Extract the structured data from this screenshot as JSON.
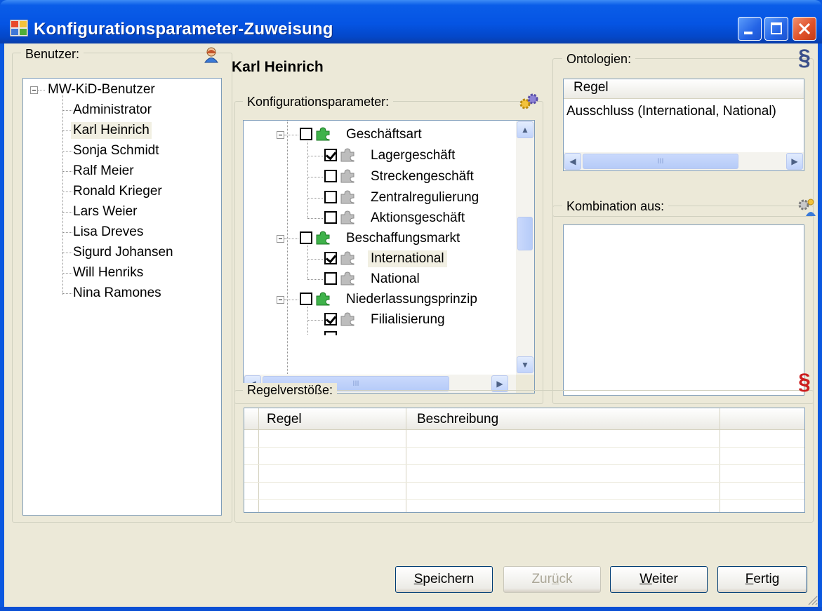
{
  "window": {
    "title": "Konfigurationsparameter-Zuweisung"
  },
  "users": {
    "label": "Benutzer:",
    "root": "MW-KiD-Benutzer",
    "items": [
      "Administrator",
      "Karl Heinrich",
      "Sonja Schmidt",
      "Ralf Meier",
      "Ronald Krieger",
      "Lars Weier",
      "Lisa Dreves",
      "Sigurd Johansen",
      "Will Henriks",
      "Nina Ramones"
    ],
    "selected": "Karl Heinrich"
  },
  "selected_user_heading": "Karl Heinrich",
  "config": {
    "label": "Konfigurationsparameter:",
    "groups": [
      {
        "label": "Geschäftsart",
        "checked": false,
        "children": [
          {
            "label": "Lagergeschäft",
            "checked": true
          },
          {
            "label": "Streckengeschäft",
            "checked": false
          },
          {
            "label": "Zentralregulierung",
            "checked": false
          },
          {
            "label": "Aktionsgeschäft",
            "checked": false
          }
        ]
      },
      {
        "label": "Beschaffungsmarkt",
        "checked": false,
        "children": [
          {
            "label": "International",
            "checked": true
          },
          {
            "label": "National",
            "checked": false
          }
        ]
      },
      {
        "label": "Niederlassungsprinzip",
        "checked": false,
        "children": [
          {
            "label": "Filialisierung",
            "checked": true
          }
        ]
      }
    ],
    "hscroll_grip": "III"
  },
  "ontologies": {
    "label": "Ontologien:",
    "column": "Regel",
    "rows": [
      "Ausschluss (International, National)"
    ],
    "hscroll_grip": "III"
  },
  "combination": {
    "label": "Kombination aus:"
  },
  "violations": {
    "label": "Regelverstöße:",
    "columns": [
      "Regel",
      "Beschreibung"
    ]
  },
  "buttons": {
    "save": {
      "pre": "",
      "key": "S",
      "post": "peichern"
    },
    "back": {
      "pre": "Zur",
      "key": "ü",
      "post": "ck"
    },
    "next": {
      "pre": "",
      "key": "W",
      "post": "eiter"
    },
    "finish": {
      "pre": "",
      "key": "F",
      "post": "ertig"
    }
  },
  "colors": {
    "title_bar": "#0554e3",
    "dialog_bg": "#ece9d8",
    "selection_bg": "#f1efe2",
    "paragraph_icon_blue": "#3b4f8a",
    "paragraph_icon_red": "#cc1f1f"
  }
}
